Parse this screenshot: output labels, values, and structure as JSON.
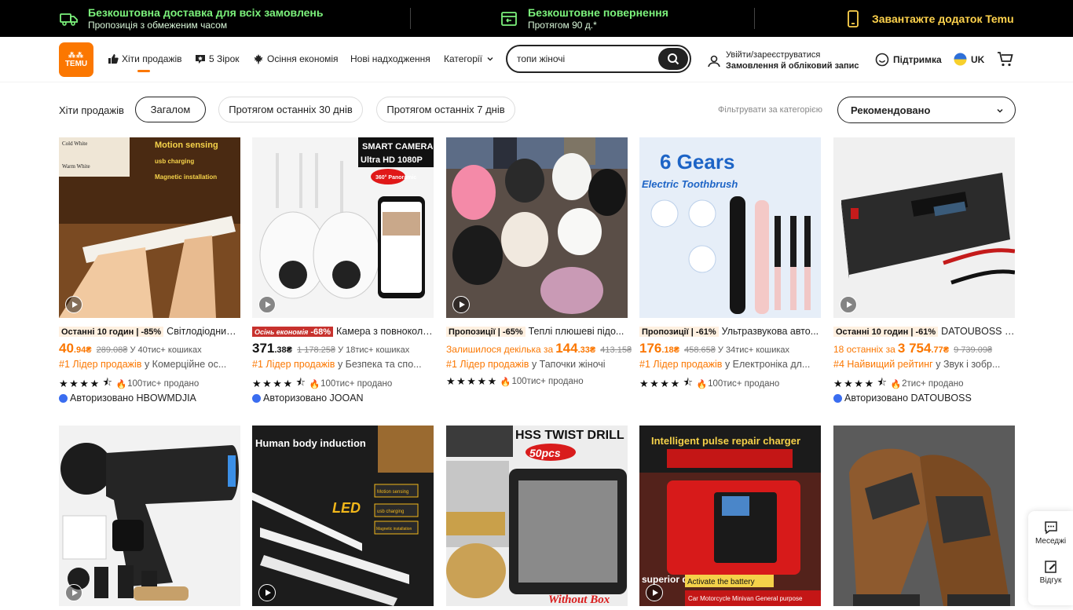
{
  "banner": {
    "shipping_title": "Безкоштовна доставка для всіх замовлень",
    "shipping_sub": "Пропозиція з обмеженим часом",
    "return_title": "Безкоштовне повернення",
    "return_sub": "Протягом 90 д.*",
    "app_text": "Завантажте додаток Temu"
  },
  "header": {
    "logo_top": "TEMU",
    "nav": [
      {
        "label": "Хіти продажів"
      },
      {
        "label": "5 Зірок"
      },
      {
        "label": "Осіння економія"
      },
      {
        "label": "Нові надходження"
      },
      {
        "label": "Категорії"
      }
    ],
    "search_value": "топи жіночі",
    "account_line1": "Увійти/зареєструватися",
    "account_line2": "Замовлення й обліковий запис",
    "support": "Підтримка",
    "lang": "UK"
  },
  "filters": {
    "label": "Хіти продажів",
    "pills": [
      "Загалом",
      "Протягом останніх 30 днів",
      "Протягом останніх 7 днів"
    ],
    "filter_cat": "Фільтрувати за категорією",
    "sort": "Рекомендовано"
  },
  "products": [
    {
      "tag": "Останні 10 годин",
      "discount": "-85%",
      "title": "Світлодіодний ...",
      "price_main": "40",
      "price_cents": ".94₴",
      "price_note": "",
      "old_price": "289.08₴",
      "carts": "У 40тис+ кошиках",
      "rank": "#1 Лідер продажів",
      "rank_cat": "у Комерційне ос...",
      "sold": "100тис+ продано",
      "auth": "Авторизовано HBOWMDJIA"
    },
    {
      "tag": "Осінь економія",
      "discount": "-68%",
      "title": "Камера з повнокольоров...",
      "price_main": "371",
      "price_cents": ".38₴",
      "price_note": "",
      "old_price": "1 178.25₴",
      "carts": "У 18тис+ кошиках",
      "rank": "#1 Лідер продажів",
      "rank_cat": "у Безпека та спо...",
      "sold": "100тис+ продано",
      "auth": "Авторизовано JOOAN"
    },
    {
      "tag": "Пропозиції",
      "discount": "-65%",
      "title": "Теплі плюшеві підо...",
      "price_main": "144",
      "price_cents": ".33₴",
      "price_note": "Залишилося декілька за",
      "old_price": "413.15₴",
      "carts": "",
      "rank": "#1 Лідер продажів",
      "rank_cat": "у Тапочки жіночі",
      "sold": "100тис+ продано",
      "auth": ""
    },
    {
      "tag": "Пропозиції",
      "discount": "-61%",
      "title": "Ультразвукова авто...",
      "price_main": "176",
      "price_cents": ".18₴",
      "price_note": "",
      "old_price": "458.65₴",
      "carts": "У 34тис+ кошиках",
      "rank": "#1 Лідер продажів",
      "rank_cat": "у Електроніка дл...",
      "sold": "100тис+ продано",
      "auth": ""
    },
    {
      "tag": "Останні 10 годин",
      "discount": "-61%",
      "title": "DATOUBOSS 15...",
      "price_main": "3 754",
      "price_cents": ".77₴",
      "price_note": "18 останніх за",
      "old_price": "9 739.09₴",
      "carts": "",
      "rank": "#4 Найвищий рейтинг",
      "rank_cat": "у Звук і зобр...",
      "sold": "2тис+ продано",
      "auth": "Авторизовано DATOUBOSS"
    }
  ],
  "row2_images": [
    {
      "caption": ""
    },
    {
      "caption": "Human body induction"
    },
    {
      "caption": "HSS TWIST DRILL"
    },
    {
      "caption": "Intelligent pulse repair charger"
    },
    {
      "caption": ""
    }
  ],
  "image_text": {
    "p1_a": "Cold White",
    "p1_b": "Warm White",
    "p1_c": "Motion sensing",
    "p1_d": "usb charging",
    "p1_e": "Magnetic installation",
    "p2_a": "SMART CAMERA",
    "p2_b": "Ultra HD 1080P",
    "p2_c": "360° Panoramic",
    "p4_a": "6 Gears",
    "p4_b": "Electric Toothbrush",
    "p7_a": "LED",
    "p7_b": "Motion sensing",
    "p7_c": "usb charging",
    "p7_d": "Magnetic installation",
    "p8_a": "50pcs",
    "p8_b": "Without Box",
    "p9_a": "superior quality",
    "p9_b": "Activate the battery",
    "p9_c": "Car Motorcycle Minivan General purpose"
  },
  "side": {
    "messages": "Меседжі",
    "feedback": "Відгук"
  },
  "colors": {
    "accent": "#fb7701",
    "banner_green": "#7cf27c",
    "banner_yellow": "#ffd34d"
  }
}
